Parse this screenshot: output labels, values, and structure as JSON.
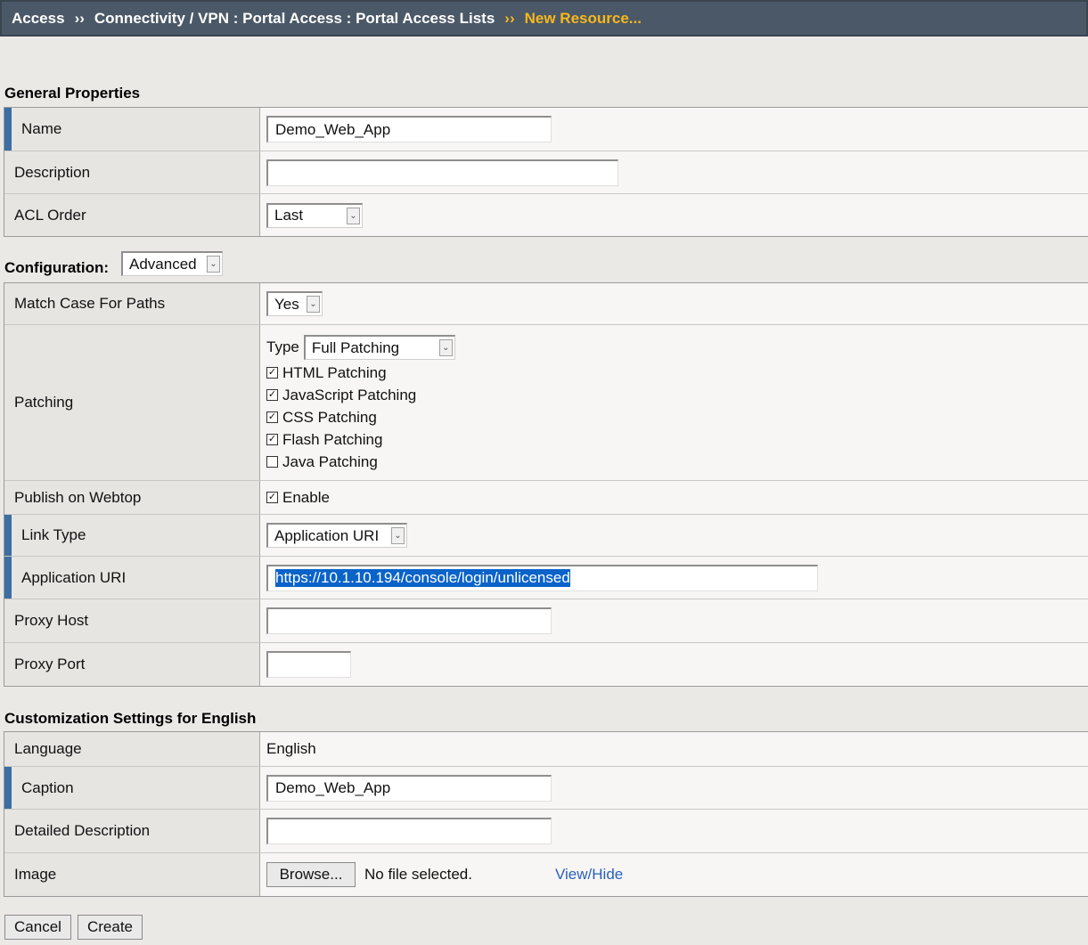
{
  "breadcrumb": {
    "root": "Access",
    "path": "Connectivity / VPN : Portal Access : Portal Access Lists",
    "current": "New Resource...",
    "separator": "››"
  },
  "general": {
    "title": "General Properties",
    "name_label": "Name",
    "name_value": "Demo_Web_App",
    "description_label": "Description",
    "description_value": "",
    "acl_order_label": "ACL Order",
    "acl_order_value": "Last"
  },
  "configuration": {
    "title": "Configuration:",
    "mode": "Advanced",
    "match_case_label": "Match Case For Paths",
    "match_case_value": "Yes",
    "patching_label": "Patching",
    "type_label": "Type",
    "type_value": "Full Patching",
    "patch_options": [
      {
        "label": "HTML Patching",
        "checked": true
      },
      {
        "label": "JavaScript Patching",
        "checked": true
      },
      {
        "label": "CSS Patching",
        "checked": true
      },
      {
        "label": "Flash Patching",
        "checked": true
      },
      {
        "label": "Java Patching",
        "checked": false
      }
    ],
    "publish_label": "Publish on Webtop",
    "publish_option": "Enable",
    "publish_checked": true,
    "link_type_label": "Link Type",
    "link_type_value": "Application URI",
    "app_uri_label": "Application URI",
    "app_uri_value": "https://10.1.10.194/console/login/unlicensed",
    "proxy_host_label": "Proxy Host",
    "proxy_host_value": "",
    "proxy_port_label": "Proxy Port",
    "proxy_port_value": ""
  },
  "customization": {
    "title": "Customization Settings for English",
    "language_label": "Language",
    "language_value": "English",
    "caption_label": "Caption",
    "caption_value": "Demo_Web_App",
    "detailed_label": "Detailed Description",
    "detailed_value": "",
    "image_label": "Image",
    "browse_label": "Browse...",
    "no_file": "No file selected.",
    "view_hide": "View/Hide"
  },
  "actions": {
    "cancel": "Cancel",
    "create": "Create"
  },
  "colors": {
    "topbar": "#4b5867",
    "breadcrumb_current": "#f7b81c",
    "required_marker": "#3c6ea2",
    "link": "#2a5fbd",
    "selection": "#0a63c9"
  }
}
